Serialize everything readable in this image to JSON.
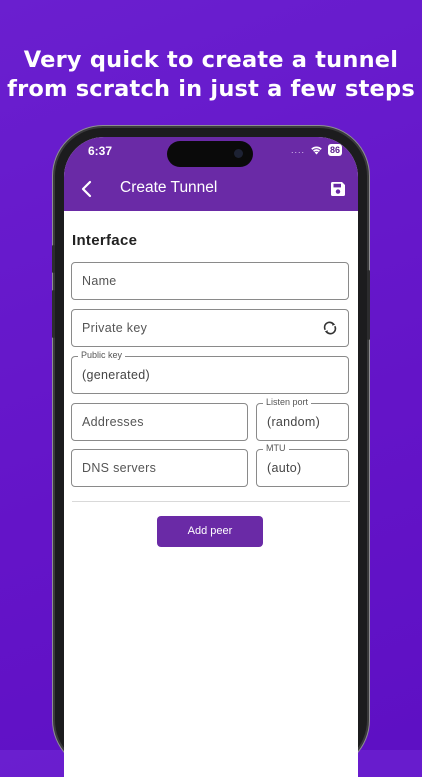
{
  "promo": {
    "line1": "Very quick to create a tunnel",
    "line2": "from scratch in just a few steps",
    "background_color": "#6414c8"
  },
  "status_bar": {
    "time": "6:37",
    "signal_dots": "....",
    "battery": "86"
  },
  "app_bar": {
    "title": "Create Tunnel",
    "back_icon": "chevron-left-icon",
    "save_icon": "save-icon",
    "color": "#6a2aa6"
  },
  "interface": {
    "section_title": "Interface",
    "name": {
      "placeholder": "Name",
      "value": ""
    },
    "private_key": {
      "placeholder": "Private key",
      "value": "",
      "action_icon": "refresh-icon"
    },
    "public_key": {
      "label": "Public key",
      "value": "(generated)"
    },
    "addresses": {
      "placeholder": "Addresses",
      "value": ""
    },
    "listen_port": {
      "label": "Listen port",
      "value": "(random)"
    },
    "dns_servers": {
      "placeholder": "DNS servers",
      "value": ""
    },
    "mtu": {
      "label": "MTU",
      "value": "(auto)"
    }
  },
  "actions": {
    "add_peer": "Add peer"
  }
}
